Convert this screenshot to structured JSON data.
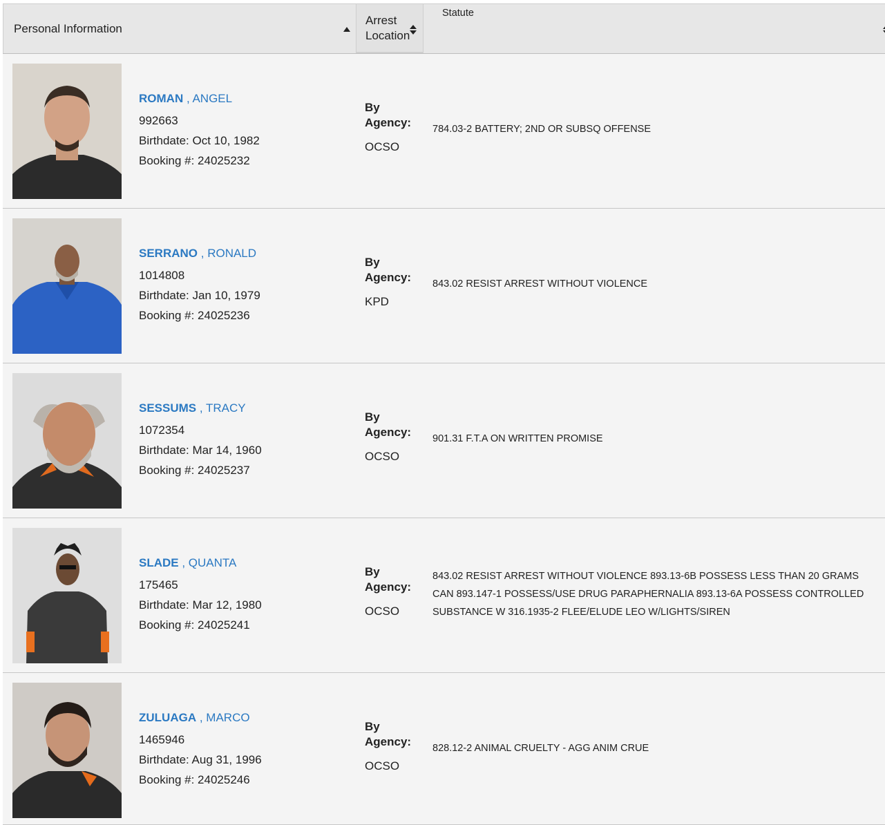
{
  "header": {
    "personal_label": "Personal Information",
    "location_label_line1": "Arrest",
    "location_label_line2": "Location",
    "statute_label": "Statute"
  },
  "agency_label_line1": "By",
  "agency_label_line2": "Agency:",
  "rows": [
    {
      "last_name": "ROMAN",
      "first_name": ", ANGEL",
      "id": "992663",
      "birthdate": "Birthdate: Oct 10, 1982",
      "booking": "Booking #: 24025232",
      "agency": "OCSO",
      "statute": "784.03-2 BATTERY; 2ND OR SUBSQ OFFENSE"
    },
    {
      "last_name": "SERRANO",
      "first_name": ", RONALD",
      "id": "1014808",
      "birthdate": "Birthdate: Jan 10, 1979",
      "booking": "Booking #: 24025236",
      "agency": "KPD",
      "statute": "843.02 RESIST ARREST WITHOUT VIOLENCE"
    },
    {
      "last_name": "SESSUMS",
      "first_name": ", TRACY",
      "id": "1072354",
      "birthdate": "Birthdate: Mar 14, 1960",
      "booking": "Booking #: 24025237",
      "agency": "OCSO",
      "statute": "901.31 F.T.A ON WRITTEN PROMISE"
    },
    {
      "last_name": "SLADE",
      "first_name": ", QUANTA",
      "id": "175465",
      "birthdate": "Birthdate: Mar 12, 1980",
      "booking": "Booking #: 24025241",
      "agency": "OCSO",
      "statute": "843.02 RESIST ARREST WITHOUT VIOLENCE 893.13-6B POSSESS LESS THAN 20 GRAMS CAN 893.147-1 POSSESS/USE DRUG PARAPHERNALIA 893.13-6A POSSESS CONTROLLED SUBSTANCE W 316.1935-2 FLEE/ELUDE LEO W/LIGHTS/SIREN"
    },
    {
      "last_name": "ZULUAGA",
      "first_name": ", MARCO",
      "id": "1465946",
      "birthdate": "Birthdate: Aug 31, 1996",
      "booking": "Booking #: 24025246",
      "agency": "OCSO",
      "statute": "828.12-2 ANIMAL CRUELTY - AGG ANIM CRUE"
    }
  ],
  "colors": {
    "name_link": "#2b79c2",
    "row_bg": "#f4f4f4",
    "header_bg": "#e7e7e7"
  }
}
